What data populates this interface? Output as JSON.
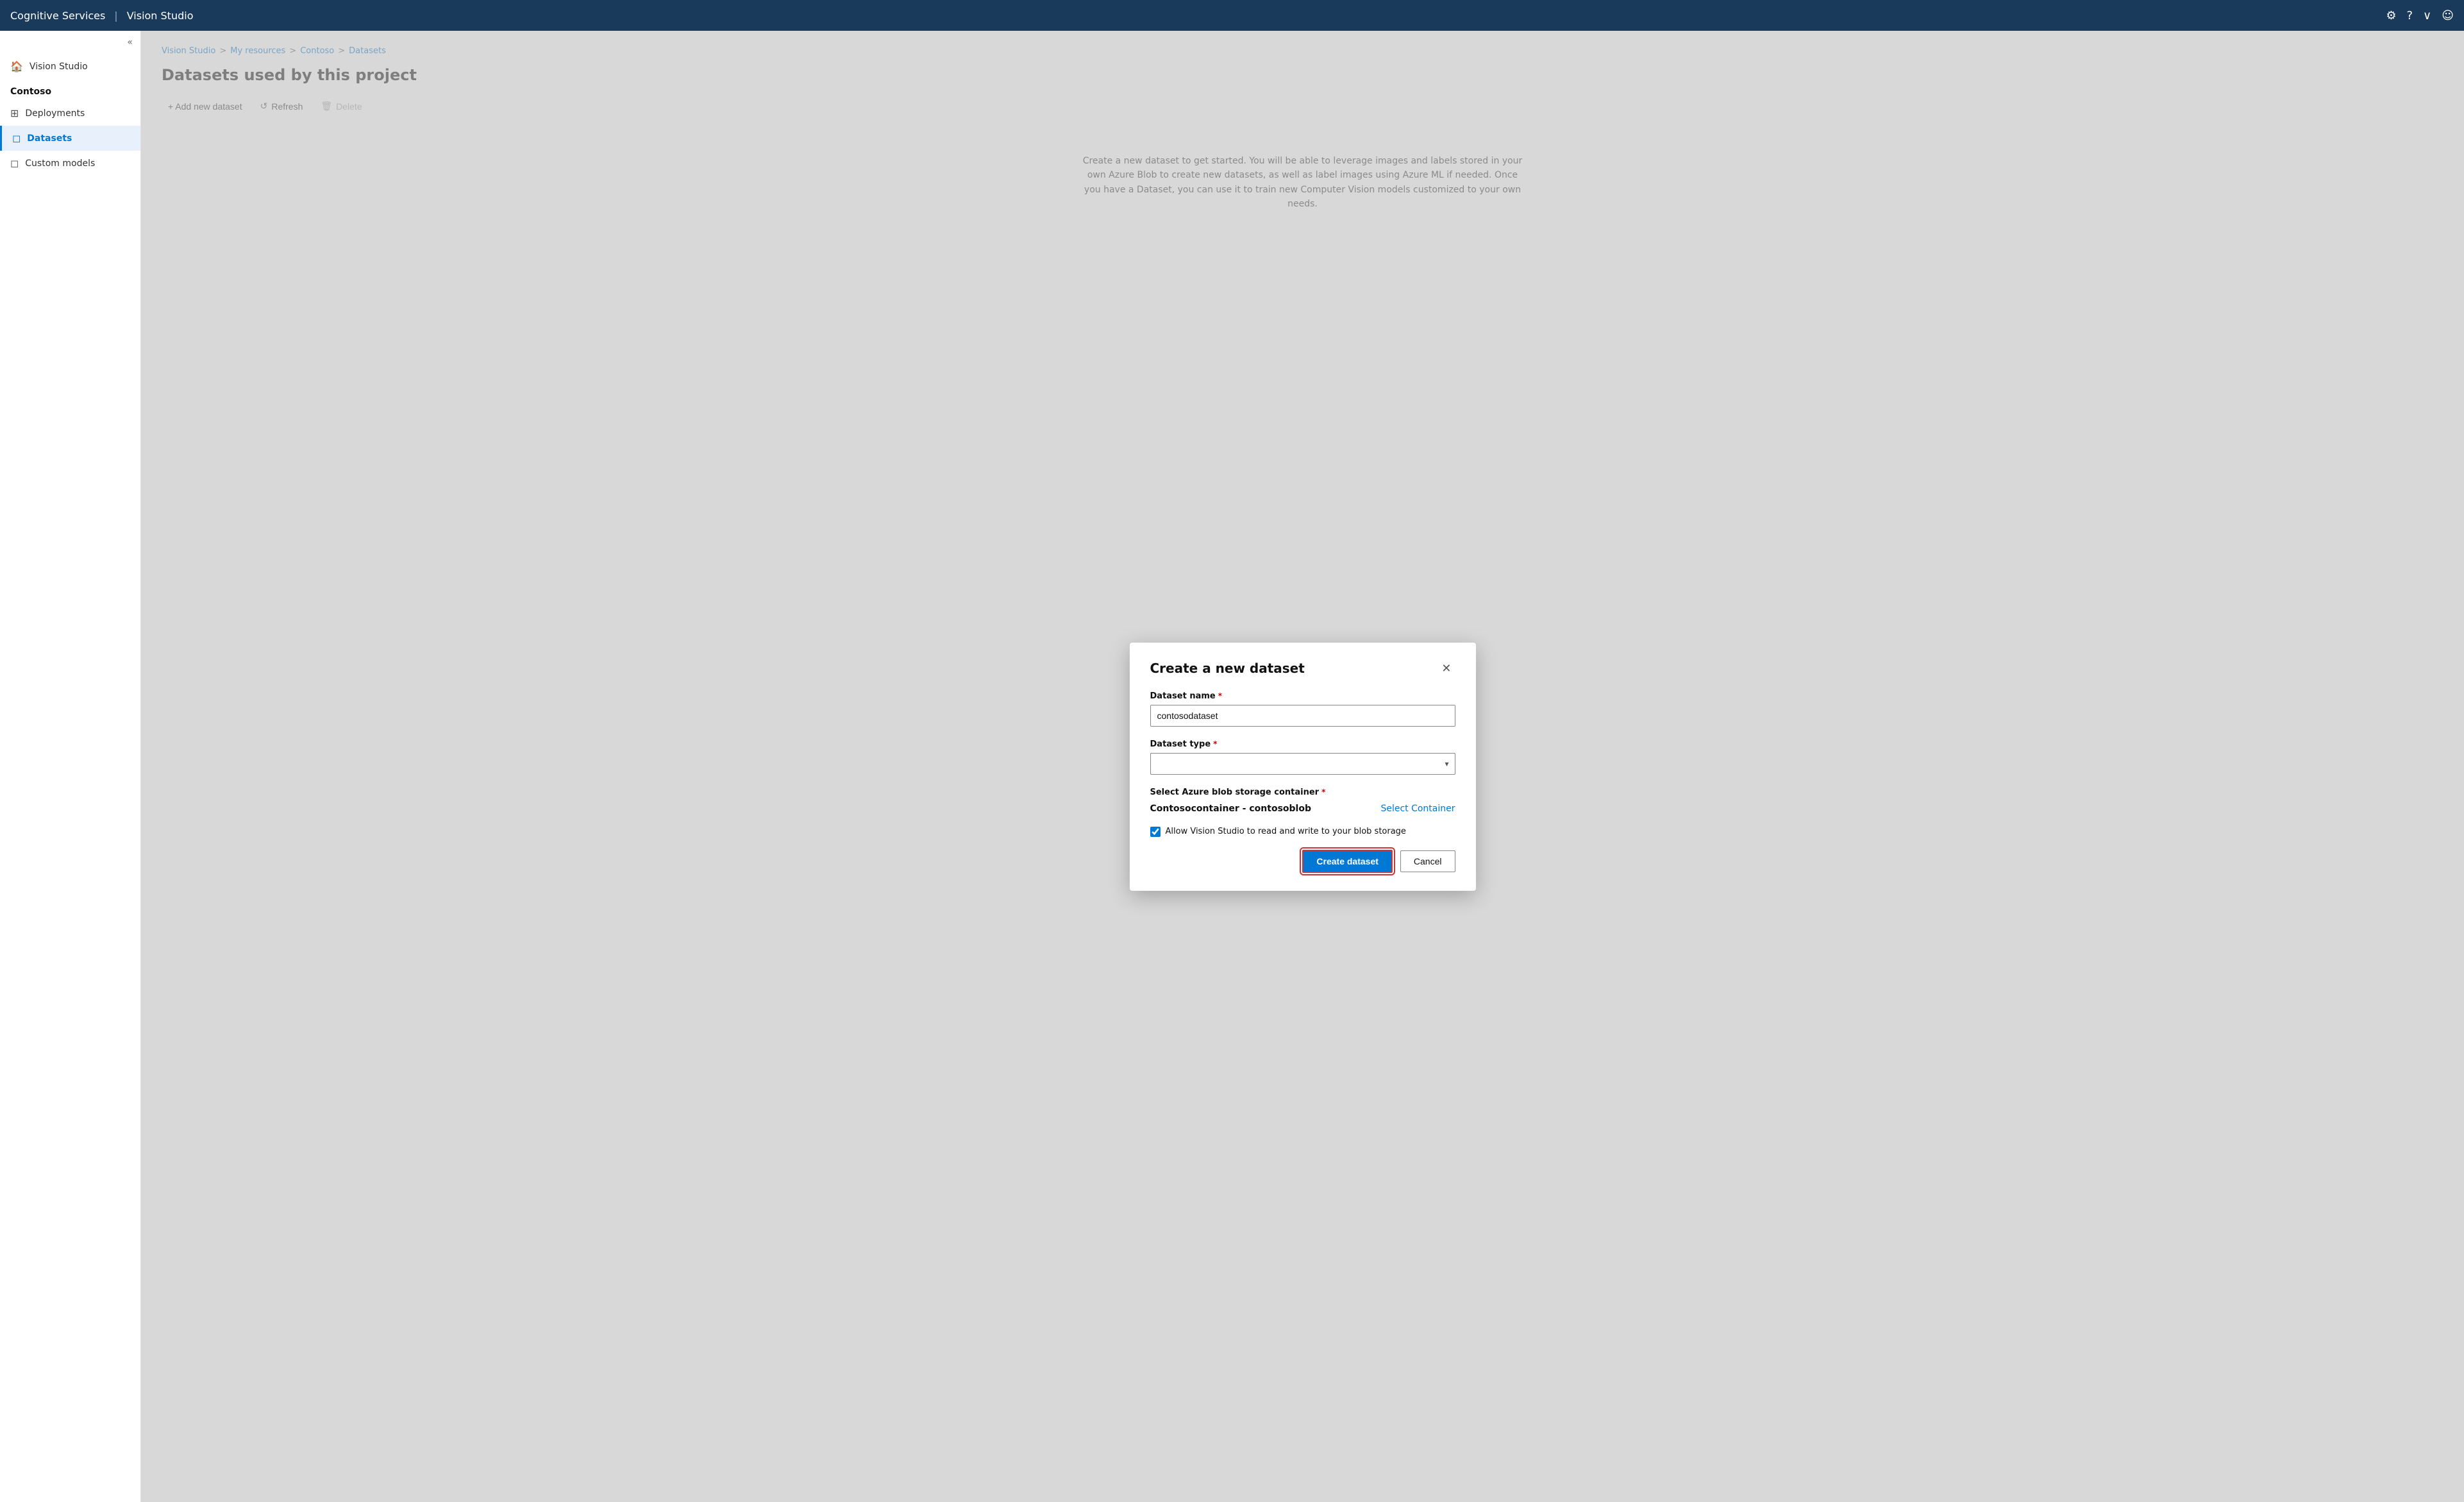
{
  "app": {
    "brand": "Cognitive Services",
    "separator": "|",
    "product": "Vision Studio"
  },
  "nav_icons": {
    "settings": "⚙",
    "help": "?",
    "chevron_down": "∨",
    "user": "☺"
  },
  "sidebar": {
    "collapse_icon": "«",
    "home_label": "Vision Studio",
    "section_label": "Contoso",
    "items": [
      {
        "id": "deployments",
        "label": "Deployments",
        "icon": "⊞"
      },
      {
        "id": "datasets",
        "label": "Datasets",
        "icon": "◻",
        "active": true
      },
      {
        "id": "custom-models",
        "label": "Custom models",
        "icon": "◻"
      }
    ]
  },
  "breadcrumb": {
    "items": [
      {
        "label": "Vision Studio",
        "link": true
      },
      {
        "label": "My resources",
        "link": true
      },
      {
        "label": "Contoso",
        "link": true
      },
      {
        "label": "Datasets",
        "link": true
      }
    ],
    "separator": ">"
  },
  "page": {
    "title": "Datasets used by this project"
  },
  "toolbar": {
    "add_label": "+ Add new dataset",
    "refresh_label": "Refresh",
    "delete_label": "Delete",
    "refresh_icon": "↺",
    "delete_icon": "🗑"
  },
  "modal": {
    "title": "Create a new dataset",
    "close_icon": "✕",
    "dataset_name_label": "Dataset name",
    "dataset_name_required": "*",
    "dataset_name_value": "contosodataset",
    "dataset_type_label": "Dataset type",
    "dataset_type_required": "*",
    "dataset_type_placeholder": "",
    "storage_label": "Select Azure blob storage container",
    "storage_required": "*",
    "storage_name": "Contosocontainer - contosoblob",
    "storage_link_label": "Select Container",
    "checkbox_label": "Allow Vision Studio to read and write to your blob storage",
    "checkbox_checked": true,
    "create_button_label": "Create dataset",
    "cancel_button_label": "Cancel"
  },
  "bg_description": "Create a new dataset to get started. You will be able to leverage images and labels stored in your own Azure Blob to create new datasets, as well as label images using Azure ML if needed. Once you have a Dataset, you can use it to train new Computer Vision models customized to your own needs."
}
